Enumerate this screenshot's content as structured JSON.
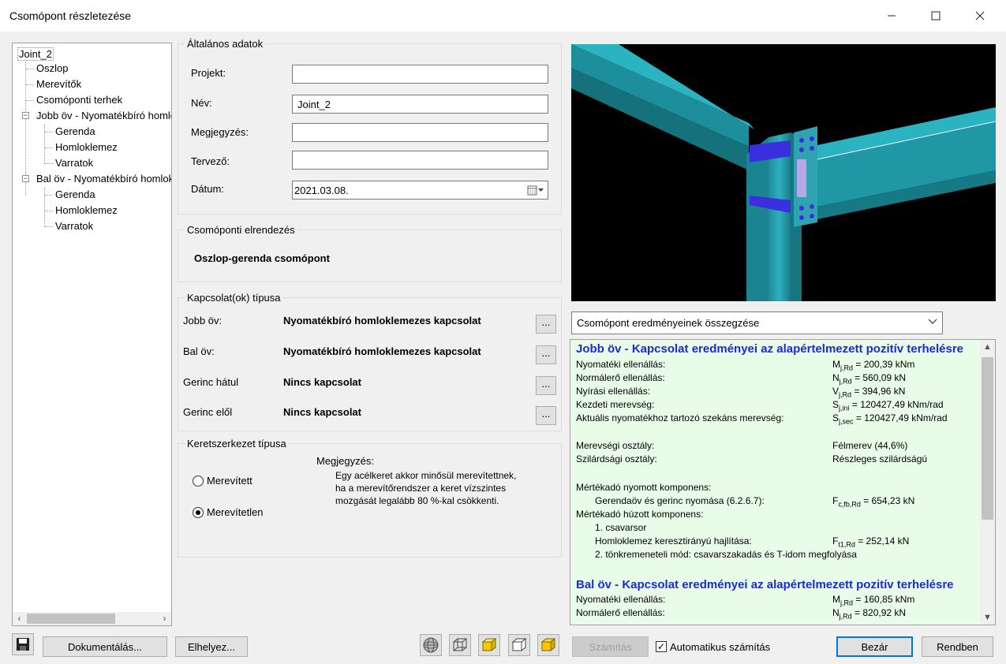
{
  "window": {
    "title": "Csomópont részletezése"
  },
  "tree": {
    "root": "Joint_2",
    "nodes": [
      {
        "label": "Oszlop"
      },
      {
        "label": "Merevítők"
      },
      {
        "label": "Csomóponti terhek"
      },
      {
        "label": "Jobb öv - Nyomatékbíró homlokl"
      },
      {
        "label": "Gerenda"
      },
      {
        "label": "Homloklemez"
      },
      {
        "label": "Varratok"
      },
      {
        "label": "Bal öv - Nyomatékbíró homlokl"
      },
      {
        "label": "Gerenda"
      },
      {
        "label": "Homloklemez"
      },
      {
        "label": "Varratok"
      }
    ]
  },
  "general": {
    "title": "Általános adatok",
    "fields": {
      "projekt": {
        "label": "Projekt:",
        "value": ""
      },
      "nev": {
        "label": "Név:",
        "value": "Joint_2"
      },
      "megjegyzes": {
        "label": "Megjegyzés:",
        "value": ""
      },
      "tervezo": {
        "label": "Tervező:",
        "value": ""
      },
      "datum": {
        "label": "Dátum:",
        "value": "2021.03.08."
      }
    }
  },
  "layout_group": {
    "title": "Csomóponti elrendezés",
    "value": "Oszlop-gerenda csomópont"
  },
  "connection": {
    "title": "Kapcsolat(ok) típusa",
    "rows": [
      {
        "label": "Jobb öv:",
        "value": "Nyomatékbíró homloklemezes kapcsolat",
        "btn": "..."
      },
      {
        "label": "Bal öv:",
        "value": "Nyomatékbíró homloklemezes kapcsolat",
        "btn": "..."
      },
      {
        "label": "Gerinc hátul",
        "value": "Nincs kapcsolat",
        "btn": "..."
      },
      {
        "label": "Gerinc elől",
        "value": "Nincs kapcsolat",
        "btn": "..."
      }
    ]
  },
  "frame": {
    "title": "Keretszerkezet típusa",
    "option_braced": "Merevített",
    "option_unbraced": "Merevítetlen",
    "selected": "Merevítetlen",
    "note_label": "Megjegyzés:",
    "note_lines": [
      "Egy acélkeret akkor minősül merevítettnek,",
      "ha a merevítőrendszer a keret vízszintes",
      "mozgását legalább 80 %-kal csökkenti."
    ]
  },
  "summary_dropdown": {
    "value": "Csomópont eredményeinek összegzése"
  },
  "results": {
    "right_title": "Jobb öv - Kapcsolat eredményei az alapértelmezett pozitív terhelésre",
    "right": [
      {
        "label": "Nyomatéki ellenállás:",
        "sym": "M",
        "sub": "j,Rd",
        "val": " = 200,39 kNm"
      },
      {
        "label": "Normálerő ellenállás:",
        "sym": "N",
        "sub": "j,Rd",
        "val": " = 560,09 kN"
      },
      {
        "label": "Nyírási ellenállás:",
        "sym": "V",
        "sub": "j,Rd",
        "val": " = 394,96 kN"
      },
      {
        "label": "Kezdeti merevség:",
        "sym": "S",
        "sub": "j,ini",
        "val": " = 120427,49 kNm/rad"
      },
      {
        "label": "Aktuális nyomatékhoz tartozó szekáns merevség:",
        "sym": "S",
        "sub": "j,sec",
        "val": " = 120427,49 kNm/rad"
      }
    ],
    "stiffness_label": "Merevségi osztály:",
    "stiffness_value": "Félmerev (44,6%)",
    "strength_label": "Szilárdsági osztály:",
    "strength_value": "Részleges szilárdságú",
    "comp_title": "Mértékadó nyomott komponens:",
    "comp_label": "Gerendaöv és gerinc nyomása (6.2.6.7):",
    "comp_sym": "F",
    "comp_sub": "c,fb,Rd",
    "comp_val": " = 654,23 kN",
    "tens_title": "Mértékadó húzott komponens:",
    "tens_row": "1. csavarsor",
    "tens_label": "Homloklemez keresztirányú hajlítása:",
    "tens_sym": "F",
    "tens_sub": "t1,Rd",
    "tens_val": " = 252,14 kN",
    "tens_mode": "2. tönkremeneteli mód: csavarszakadás és T-idom megfolyása",
    "left_title": "Bal öv - Kapcsolat eredményei az alapértelmezett pozitív terhelésre",
    "left": [
      {
        "label": "Nyomatéki ellenállás:",
        "sym": "M",
        "sub": "j,Rd",
        "val": " = 160,85 kNm"
      },
      {
        "label": "Normálerő ellenállás:",
        "sym": "N",
        "sub": "j,Rd",
        "val": " = 820,92 kN"
      }
    ]
  },
  "buttons": {
    "documentation": "Dokumentálás...",
    "place": "Elhelyez...",
    "calculate": "Számítás",
    "auto_calc": "Automatikus számítás",
    "close": "Bezár",
    "ok": "Rendben"
  },
  "colors": {
    "results_bg": "#e8fce8",
    "heading": "#1a2ad6",
    "steel": "#1e9aa8"
  }
}
